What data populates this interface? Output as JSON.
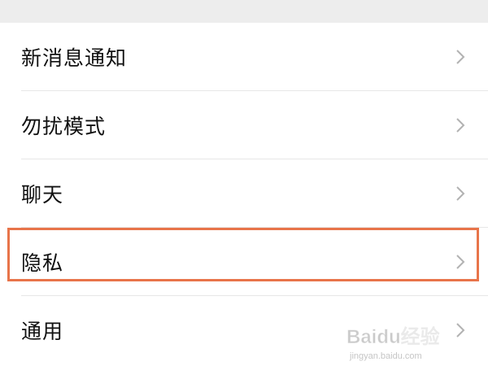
{
  "settings": {
    "items": [
      {
        "label": "新消息通知"
      },
      {
        "label": "勿扰模式"
      },
      {
        "label": "聊天"
      },
      {
        "label": "隐私",
        "highlighted": true
      },
      {
        "label": "通用"
      }
    ]
  },
  "icons": {
    "chevron": "chevron-right-icon"
  },
  "colors": {
    "background": "#ededed",
    "row_background": "#ffffff",
    "text": "#111111",
    "chevron": "#b2b2b2",
    "highlight_border": "#e8744a"
  },
  "watermark": {
    "logo": "Baidu经验",
    "url": "jingyan.baidu.com"
  }
}
